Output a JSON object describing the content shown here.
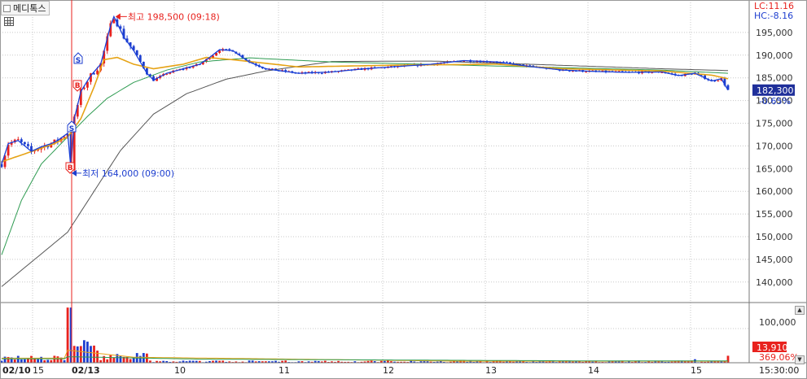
{
  "title": "메디톡스",
  "lc": "LC:11.16",
  "hc": "HC:-8.16",
  "current_price": "182,300",
  "change_pct": "-0.65%",
  "high_label": "최고 198,500 (09:18)",
  "low_label": "최저 164,000 (09:00)",
  "volume_box": "13,910",
  "volume_pct": "369.06%",
  "volume_tick": "100,000",
  "time_label": "15:30:00",
  "marker_s": "S",
  "marker_b": "B",
  "colors": {
    "up": "#e8221e",
    "down": "#1d3ecf",
    "ma5": "#1a3fd6",
    "ma20": "#e6a316",
    "ma60": "#2e9b51",
    "ma120": "#555555",
    "grid": "#c8c8c8",
    "pricebox": "#1f2f9a"
  },
  "icons": {
    "grid": "grid-icon",
    "scroll_up": "scroll-up-icon",
    "scroll_down": "scroll-down-icon"
  },
  "chart_data": {
    "type": "candlestick",
    "y_ticks": [
      "195,000",
      "190,000",
      "185,000",
      "180,000",
      "175,000",
      "170,000",
      "165,000",
      "160,000",
      "155,000",
      "150,000",
      "145,000",
      "140,000"
    ],
    "y_range": [
      136000,
      199000
    ],
    "x_ticks": [
      "02/10",
      "15",
      "02/13",
      "10",
      "11",
      "12",
      "13",
      "14",
      "15"
    ],
    "price_path": [
      [
        0,
        166000
      ],
      [
        2,
        170500
      ],
      [
        5,
        171200
      ],
      [
        9,
        168800
      ],
      [
        12,
        169800
      ],
      [
        15,
        170500
      ],
      [
        17,
        171200
      ],
      [
        20,
        172800
      ],
      [
        21,
        165000
      ],
      [
        22,
        176000
      ],
      [
        24,
        182000
      ],
      [
        27,
        185500
      ],
      [
        30,
        188000
      ],
      [
        33,
        196500
      ],
      [
        34,
        198500
      ],
      [
        37,
        194000
      ],
      [
        40,
        191000
      ],
      [
        44,
        186000
      ],
      [
        46,
        184500
      ],
      [
        50,
        186000
      ],
      [
        55,
        187000
      ],
      [
        60,
        188000
      ],
      [
        63,
        189500
      ],
      [
        66,
        191200
      ],
      [
        70,
        191000
      ],
      [
        75,
        188500
      ],
      [
        80,
        187000
      ],
      [
        90,
        186000
      ],
      [
        100,
        186300
      ],
      [
        110,
        187000
      ],
      [
        120,
        187500
      ],
      [
        130,
        188000
      ],
      [
        140,
        188800
      ],
      [
        150,
        188500
      ],
      [
        160,
        187500
      ],
      [
        170,
        186700
      ],
      [
        180,
        186400
      ],
      [
        190,
        186200
      ],
      [
        200,
        186300
      ],
      [
        205,
        185500
      ],
      [
        210,
        186000
      ],
      [
        215,
        184300
      ],
      [
        218,
        184800
      ],
      [
        220,
        182300
      ]
    ],
    "ma20_path": [
      [
        0,
        166500
      ],
      [
        10,
        169000
      ],
      [
        16,
        170500
      ],
      [
        20,
        172000
      ],
      [
        24,
        176000
      ],
      [
        28,
        183000
      ],
      [
        31,
        189000
      ],
      [
        35,
        189500
      ],
      [
        40,
        188000
      ],
      [
        46,
        187000
      ],
      [
        55,
        188000
      ],
      [
        62,
        189500
      ],
      [
        70,
        189000
      ],
      [
        90,
        187400
      ],
      [
        120,
        187800
      ],
      [
        150,
        188000
      ],
      [
        170,
        187000
      ],
      [
        200,
        186500
      ],
      [
        215,
        185600
      ],
      [
        220,
        184800
      ]
    ],
    "ma60_path": [
      [
        0,
        146000
      ],
      [
        6,
        158000
      ],
      [
        12,
        166000
      ],
      [
        18,
        170500
      ],
      [
        22,
        173500
      ],
      [
        26,
        176500
      ],
      [
        32,
        180500
      ],
      [
        40,
        184000
      ],
      [
        50,
        186700
      ],
      [
        60,
        188500
      ],
      [
        75,
        189400
      ],
      [
        100,
        188500
      ],
      [
        150,
        187600
      ],
      [
        200,
        186700
      ],
      [
        220,
        186000
      ]
    ],
    "ma120_path": [
      [
        0,
        139000
      ],
      [
        10,
        145000
      ],
      [
        20,
        151000
      ],
      [
        28,
        160000
      ],
      [
        36,
        169000
      ],
      [
        46,
        177000
      ],
      [
        56,
        181500
      ],
      [
        68,
        184700
      ],
      [
        80,
        186500
      ],
      [
        100,
        188600
      ],
      [
        130,
        188700
      ],
      [
        160,
        188000
      ],
      [
        200,
        187000
      ],
      [
        220,
        186600
      ]
    ],
    "annotations": {
      "high": 198500,
      "low": 164000,
      "current": 182300
    },
    "volume_range": [
      0,
      120000
    ],
    "volume_ticks": [
      "100,000"
    ]
  }
}
